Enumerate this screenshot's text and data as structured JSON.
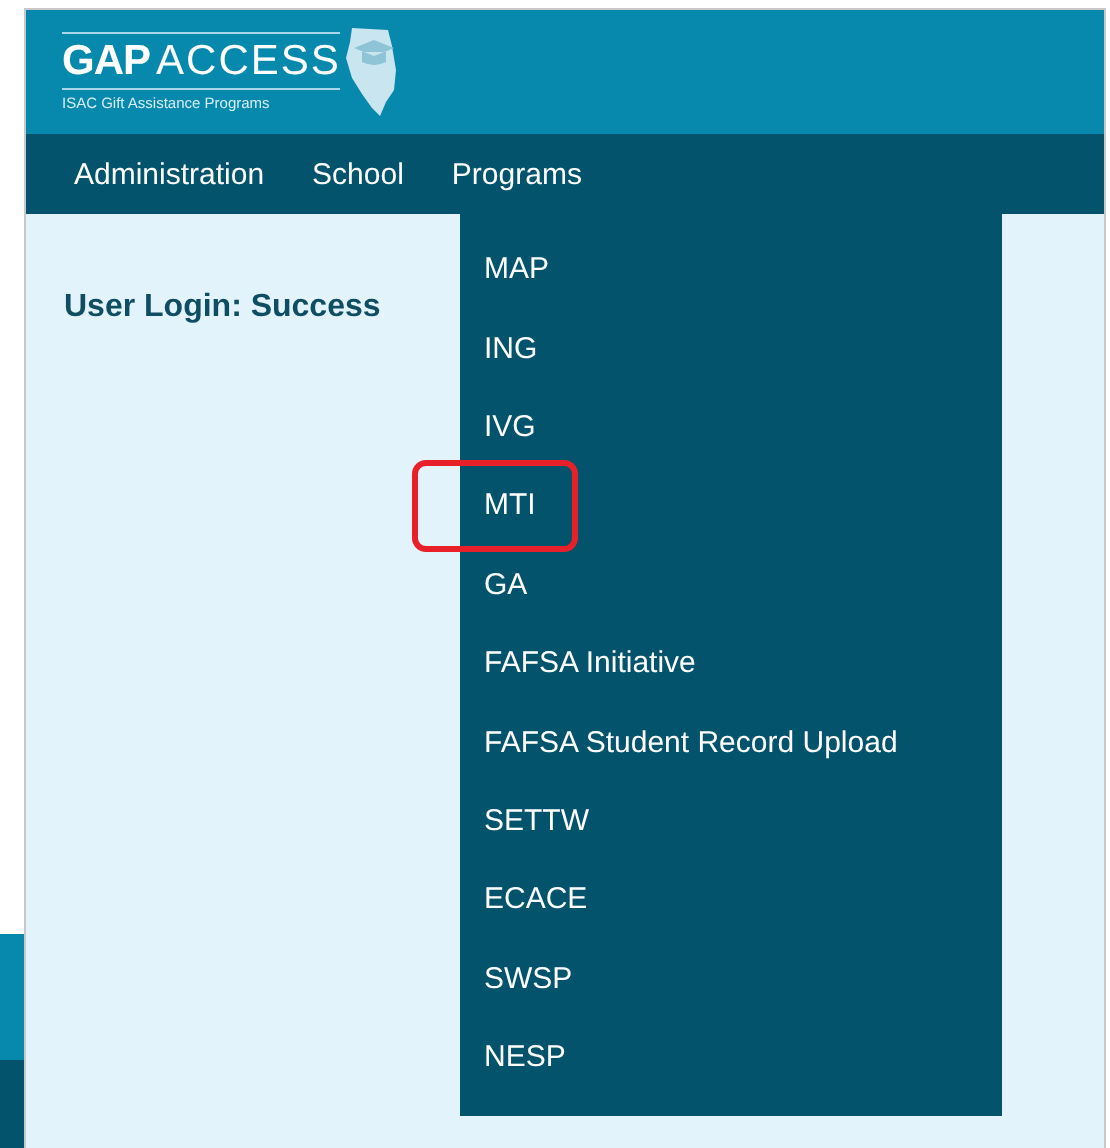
{
  "logo": {
    "title_bold": "GAP",
    "title_light": "ACCESS",
    "subtitle": "ISAC Gift Assistance Programs"
  },
  "nav": [
    {
      "label": "Administration"
    },
    {
      "label": "School"
    },
    {
      "label": "Programs"
    }
  ],
  "message": "User Login: Success",
  "menu": [
    {
      "label": "MAP",
      "highlighted": false
    },
    {
      "label": "ING",
      "highlighted": false
    },
    {
      "label": "IVG",
      "highlighted": false
    },
    {
      "label": "MTI",
      "highlighted": true
    },
    {
      "label": "GA",
      "highlighted": false
    },
    {
      "label": "FAFSA Initiative",
      "highlighted": false
    },
    {
      "label": "FAFSA Student Record Upload",
      "highlighted": false
    },
    {
      "label": "SETTW",
      "highlighted": false
    },
    {
      "label": "ECACE",
      "highlighted": false
    },
    {
      "label": "SWSP",
      "highlighted": false
    },
    {
      "label": "NESP",
      "highlighted": false
    }
  ]
}
